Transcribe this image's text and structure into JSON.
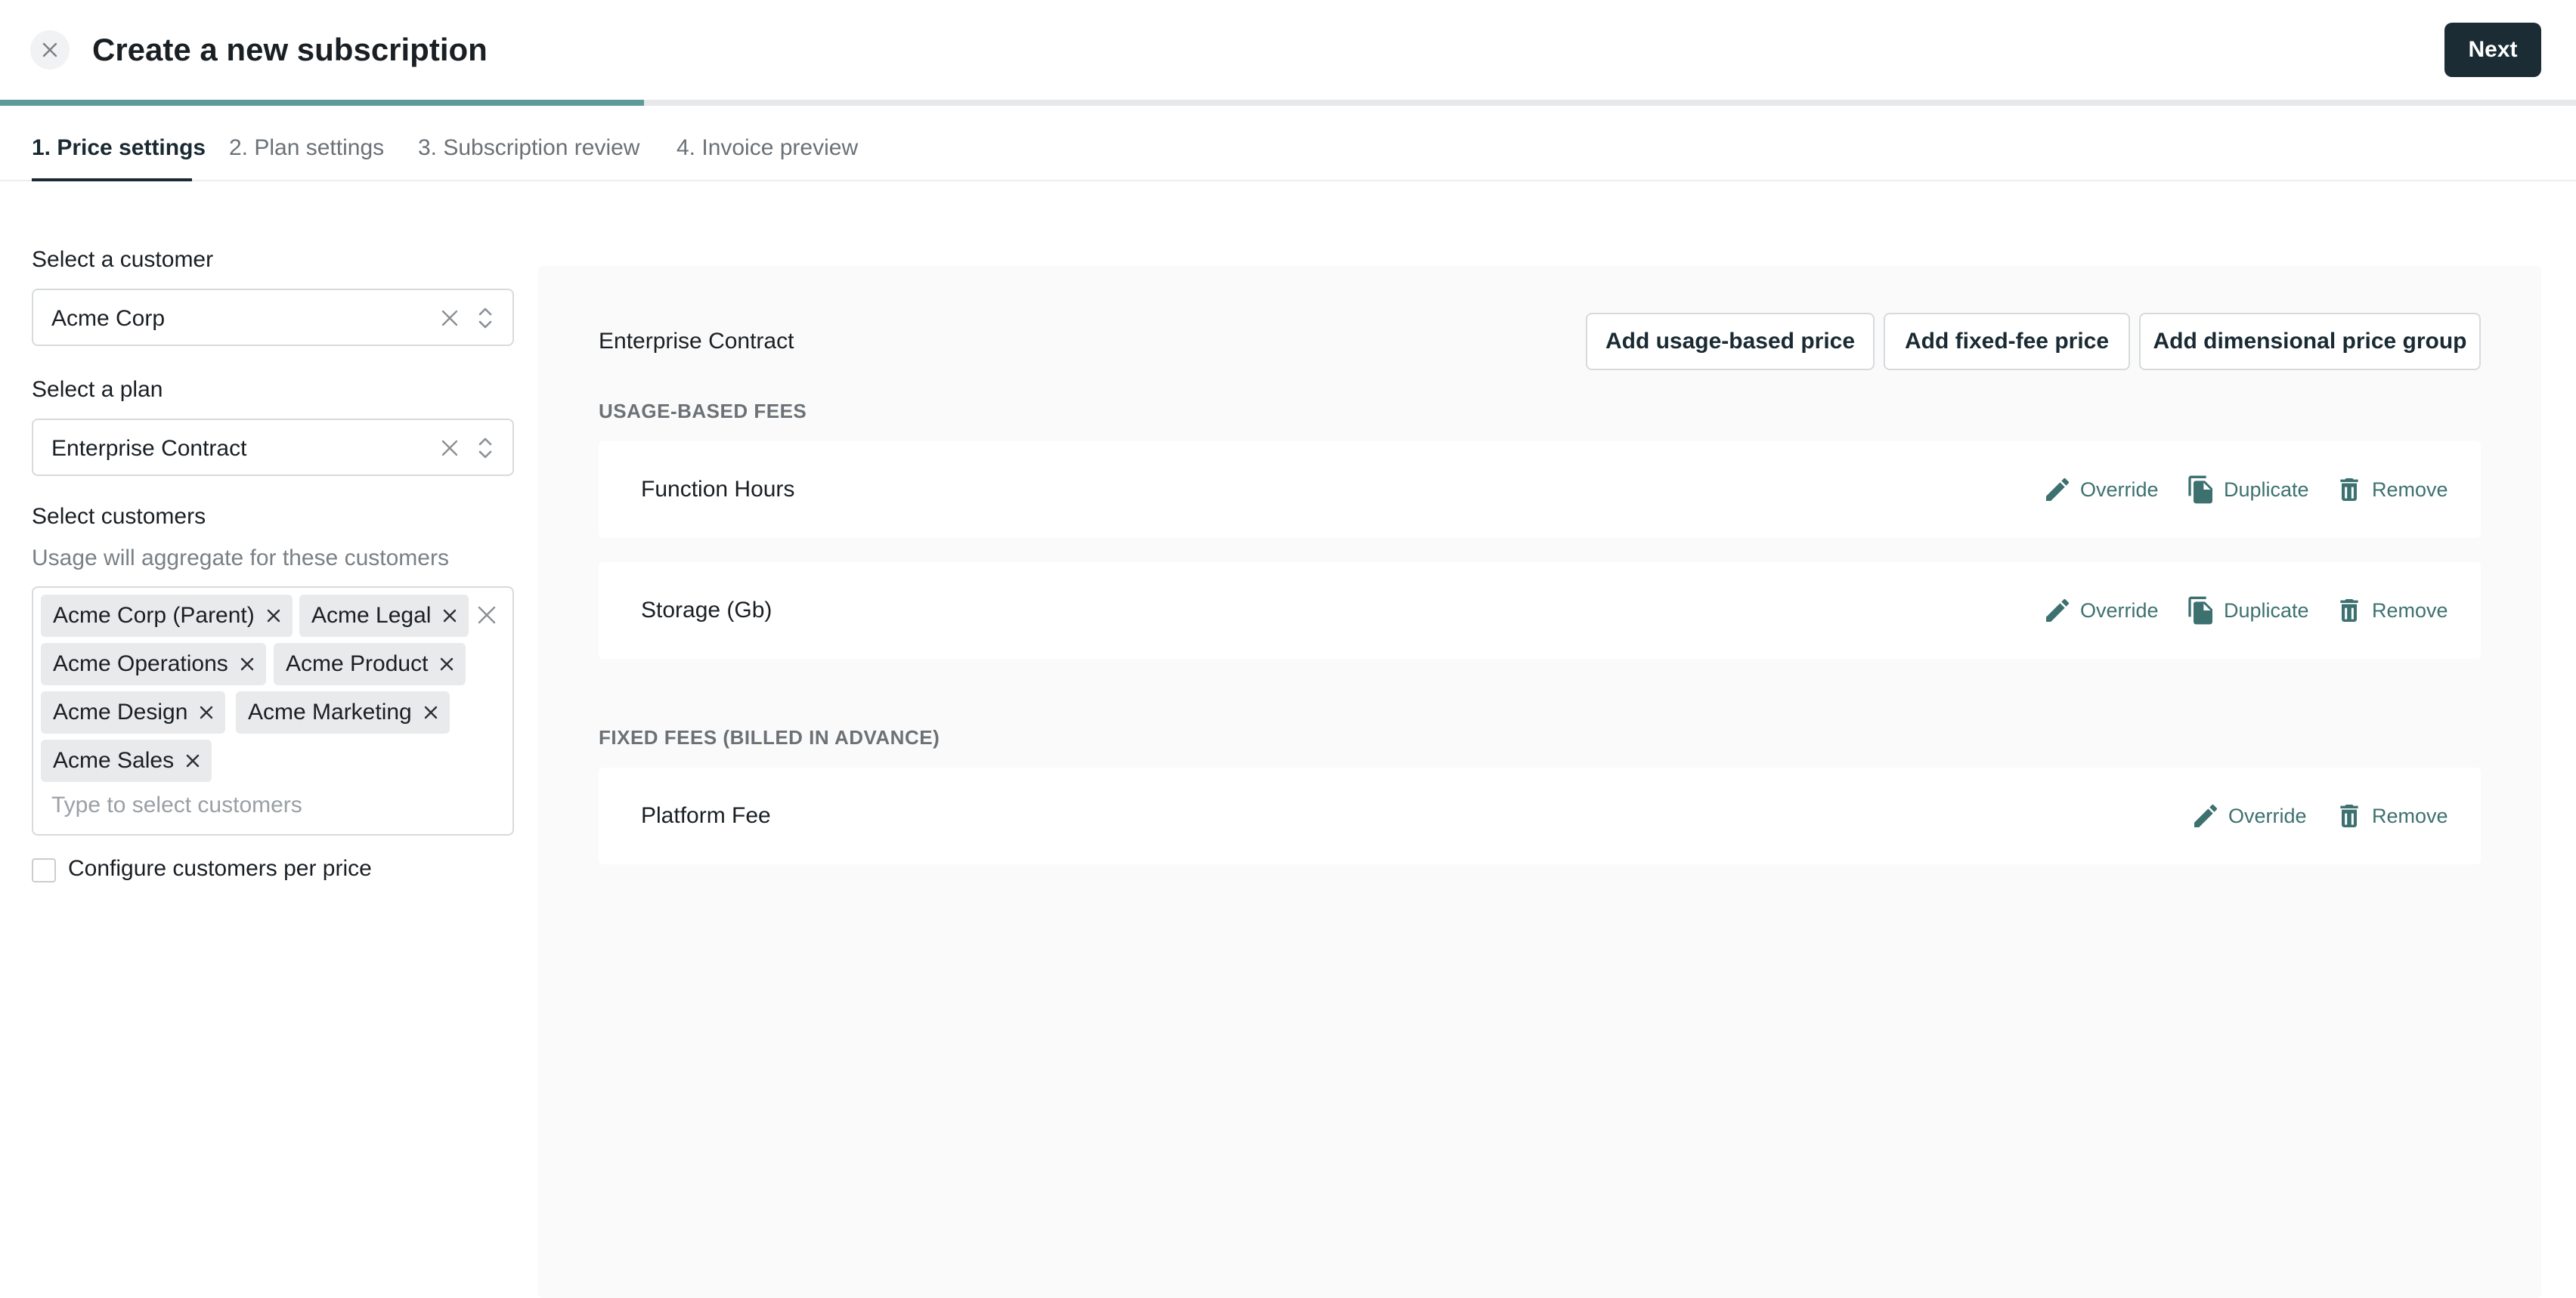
{
  "header": {
    "title": "Create a new subscription",
    "next_label": "Next",
    "progress": 0.25
  },
  "tabs": [
    {
      "label": "1. Price settings",
      "active": true
    },
    {
      "label": "2. Plan settings",
      "active": false
    },
    {
      "label": "3. Subscription review",
      "active": false
    },
    {
      "label": "4. Invoice preview",
      "active": false
    }
  ],
  "form": {
    "customer_label": "Select a customer",
    "customer_value": "Acme Corp",
    "plan_label": "Select a plan",
    "plan_value": "Enterprise Contract",
    "customers_label": "Select customers",
    "customers_hint": "Usage will aggregate for these customers",
    "customers_selected": [
      "Acme Corp (Parent)",
      "Acme Legal",
      "Acme Operations",
      "Acme Product",
      "Acme Design",
      "Acme Marketing",
      "Acme Sales"
    ],
    "customers_placeholder": "Type to select customers",
    "configure_per_price_label": "Configure customers per price",
    "configure_per_price_checked": false
  },
  "panel": {
    "plan_name": "Enterprise Contract",
    "add_usage_label": "Add usage-based price",
    "add_fixed_label": "Add fixed-fee price",
    "add_dimensional_label": "Add dimensional price group",
    "usage_heading": "USAGE-BASED FEES",
    "usage_prices": [
      {
        "name": "Function Hours"
      },
      {
        "name": "Storage (Gb)"
      }
    ],
    "fixed_heading": "FIXED FEES (BILLED IN ADVANCE)",
    "fixed_prices": [
      {
        "name": "Platform Fee"
      }
    ],
    "actions": {
      "override": "Override",
      "duplicate": "Duplicate",
      "remove": "Remove"
    }
  },
  "colors": {
    "accent": "#5f9a99",
    "primary_button": "#1b2c34",
    "action_text": "#3d7170",
    "panel_bg": "#fafafa"
  }
}
